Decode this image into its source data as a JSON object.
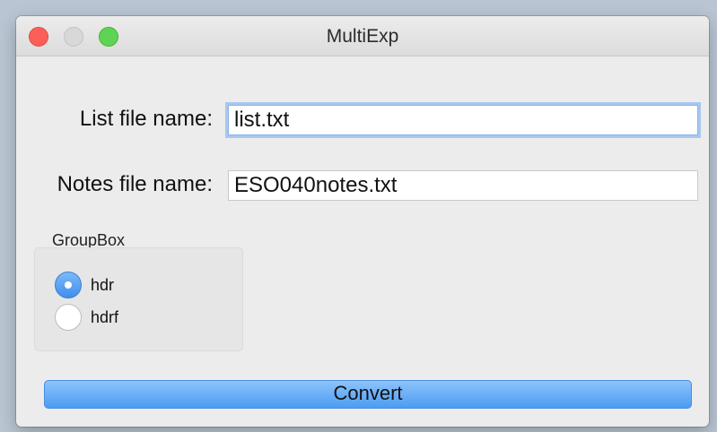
{
  "window": {
    "title": "MultiExp"
  },
  "form": {
    "list_label": "List file name:",
    "list_value": "list.txt",
    "notes_label": "Notes file name:",
    "notes_value": "ESO040notes.txt"
  },
  "groupbox": {
    "title": "GroupBox",
    "options": [
      {
        "label": "hdr",
        "selected": true
      },
      {
        "label": "hdrf",
        "selected": false
      }
    ]
  },
  "actions": {
    "convert_label": "Convert"
  },
  "colors": {
    "accent": "#4d9cf4",
    "focus_ring": "#a6c8f1",
    "close": "#fc5f57",
    "maximize": "#5fd454"
  },
  "icons": {
    "close": "close-icon",
    "minimize": "minimize-icon",
    "maximize": "maximize-icon"
  }
}
